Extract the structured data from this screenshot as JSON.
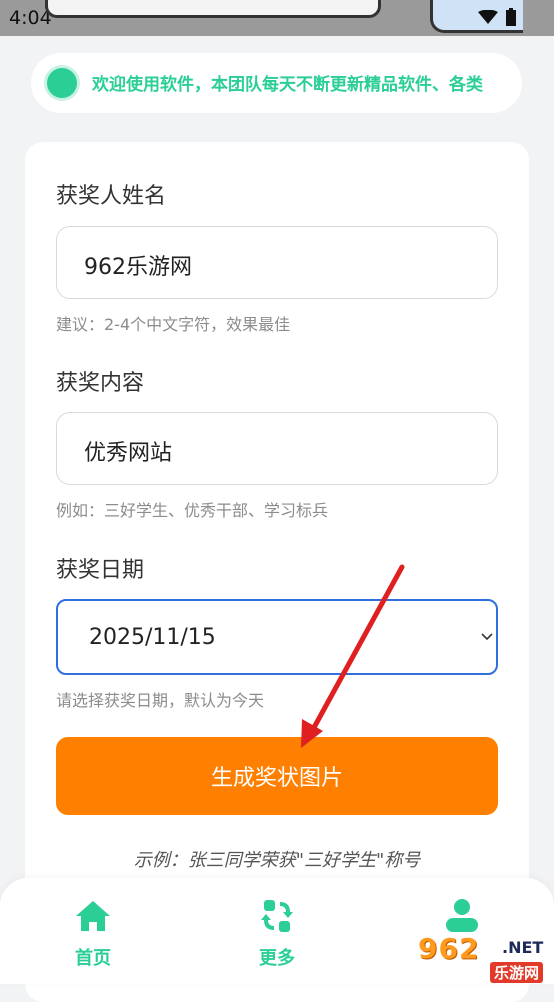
{
  "status_bar": {
    "time": "4:04"
  },
  "notice": {
    "text": "欢迎使用软件，本团队每天不断更新精品软件、各类"
  },
  "form": {
    "name_label": "获奖人姓名",
    "name_value": "962乐游网",
    "name_hint": "建议：2-4个中文字符，效果最佳",
    "content_label": "获奖内容",
    "content_value": "优秀网站",
    "content_hint": "例如：三好学生、优秀干部、学习标兵",
    "date_label": "获奖日期",
    "date_value": "2025/11/15",
    "date_hint": "请选择获奖日期，默认为今天",
    "submit_label": "生成奖状图片",
    "example_text": "示例：张三同学荣获\"三好学生\"称号"
  },
  "bottom_nav": {
    "items": [
      {
        "label": "首页",
        "icon": "home-icon"
      },
      {
        "label": "更多",
        "icon": "refresh-grid-icon"
      },
      {
        "label": "",
        "icon": "user-icon"
      }
    ]
  },
  "watermark": {
    "number": "962",
    "domain": ".NET",
    "name": "乐游网"
  },
  "colors": {
    "accent": "#2bcf95",
    "button": "#ff7f00",
    "select_border": "#2f6fde",
    "arrow": "#e02020"
  }
}
